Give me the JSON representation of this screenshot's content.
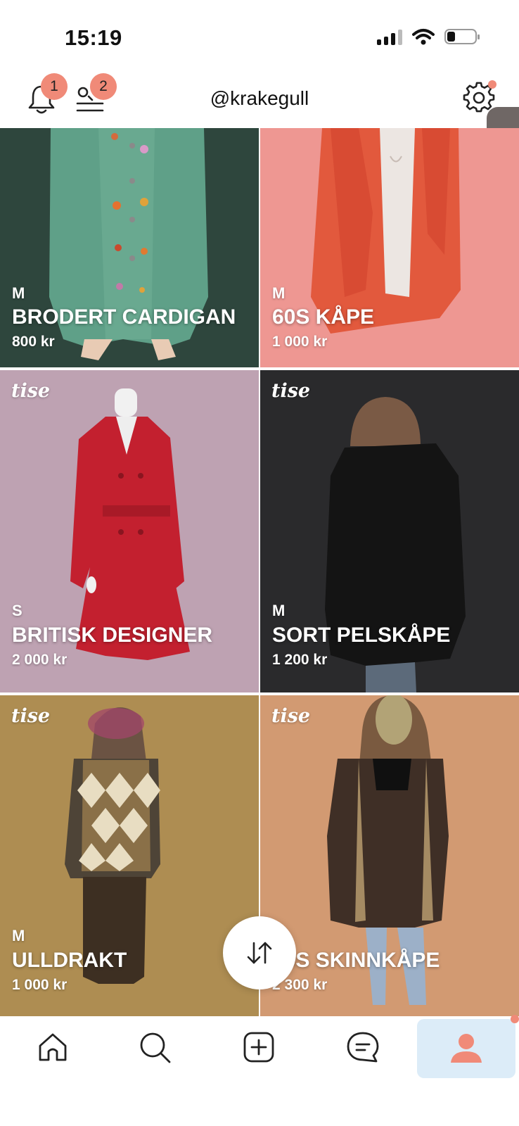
{
  "status_bar": {
    "time": "15:19"
  },
  "header": {
    "username": "@krakegull",
    "notification_count": "1",
    "menu_count": "2"
  },
  "brand_logo": "tise",
  "colors": {
    "accent": "#f08a78",
    "active_nav_bg": "#dcecf8"
  },
  "listings": [
    {
      "size": "M",
      "title": "BRODERT CARDIGAN",
      "price": "800 kr",
      "bg": "#2e463d"
    },
    {
      "size": "M",
      "title": "60S KÅPE",
      "price": "1 000 kr",
      "bg": "#ee9792"
    },
    {
      "size": "S",
      "title": "BRITISK DESIGNER",
      "price": "2 000 kr",
      "bg": "#bea2b2"
    },
    {
      "size": "M",
      "title": "SORT PELSKÅPE",
      "price": "1 200 kr",
      "bg": "#2a2a2c"
    },
    {
      "size": "M",
      "title": "ULLDRAKT",
      "price": "1 000 kr",
      "bg": "#ae8d52"
    },
    {
      "size": "",
      "title": "70S SKINNKÅPE",
      "price": "2 300 kr",
      "bg": "#d29a72"
    }
  ],
  "bottom_nav": [
    "home-icon",
    "search-icon",
    "add-icon",
    "messages-icon",
    "profile-icon"
  ]
}
